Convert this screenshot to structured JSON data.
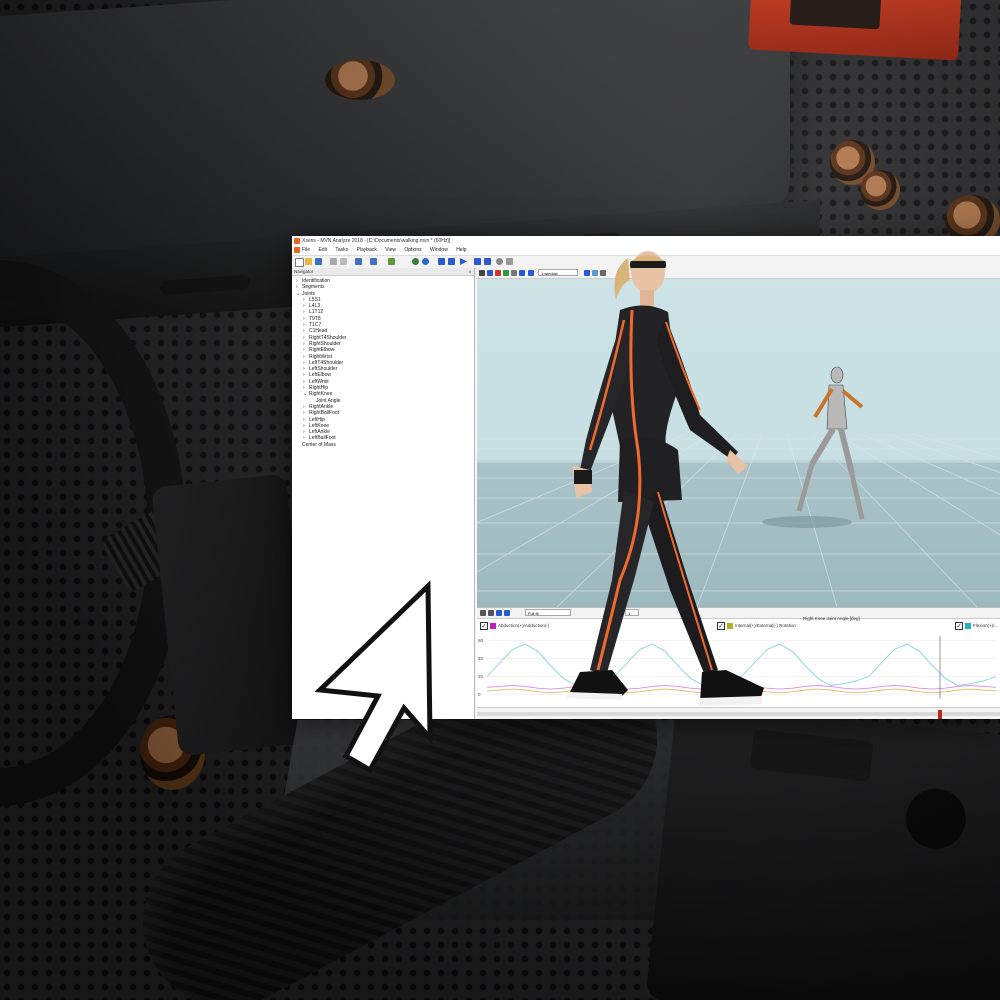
{
  "window": {
    "title": "Xsens - MVN Analyze 2018 - [C:\\Documents\\walking.mvn * (60Hz)]"
  },
  "menu": [
    "File",
    "Edit",
    "Tasks",
    "Playback",
    "View",
    "Options",
    "Window",
    "Help"
  ],
  "navigator": {
    "title": "Navigator",
    "close": "x",
    "items": [
      {
        "label": "Identification",
        "level": 1,
        "expander": "›"
      },
      {
        "label": "Segments",
        "level": 1,
        "expander": "›"
      },
      {
        "label": "Joints",
        "level": 1,
        "expander": "⌄"
      },
      {
        "label": "L5S1",
        "level": 2,
        "expander": "›"
      },
      {
        "label": "L4L3",
        "level": 2,
        "expander": "›"
      },
      {
        "label": "L1T12",
        "level": 2,
        "expander": "›"
      },
      {
        "label": "T9T8",
        "level": 2,
        "expander": "›"
      },
      {
        "label": "T1C7",
        "level": 2,
        "expander": "›"
      },
      {
        "label": "C1Head",
        "level": 2,
        "expander": "›"
      },
      {
        "label": "RightT4Shoulder",
        "level": 2,
        "expander": "›"
      },
      {
        "label": "RightShoulder",
        "level": 2,
        "expander": "›"
      },
      {
        "label": "RightElbow",
        "level": 2,
        "expander": "›"
      },
      {
        "label": "RightWrist",
        "level": 2,
        "expander": "›"
      },
      {
        "label": "LeftT4Shoulder",
        "level": 2,
        "expander": "›"
      },
      {
        "label": "LeftShoulder",
        "level": 2,
        "expander": "›"
      },
      {
        "label": "LeftElbow",
        "level": 2,
        "expander": "›"
      },
      {
        "label": "LeftWrist",
        "level": 2,
        "expander": "›"
      },
      {
        "label": "RightHip",
        "level": 2,
        "expander": "›"
      },
      {
        "label": "RightKnee",
        "level": 2,
        "expander": "⌄"
      },
      {
        "label": "Joint Angle",
        "level": 3,
        "expander": ""
      },
      {
        "label": "RightAnkle",
        "level": 2,
        "expander": "›"
      },
      {
        "label": "RightBallFoot",
        "level": 2,
        "expander": "›"
      },
      {
        "label": "LeftHip",
        "level": 2,
        "expander": "›"
      },
      {
        "label": "LeftKnee",
        "level": 2,
        "expander": "›"
      },
      {
        "label": "LeftAnkle",
        "level": 2,
        "expander": "›"
      },
      {
        "label": "LeftBallFoot",
        "level": 2,
        "expander": "›"
      },
      {
        "label": "Center of Mass",
        "level": 1,
        "expander": ""
      }
    ]
  },
  "viewport": {
    "window_select": "1 window"
  },
  "graph": {
    "zoom_select": "Full fit",
    "page_spin": "1",
    "page_spin2": "1",
    "title": "Right Knee Joint Angle [deg]",
    "legend": [
      {
        "label": "Abduction(+)/Adduction(-)",
        "color": "#c020c0"
      },
      {
        "label": "Internal(+)/External(-) Rotation",
        "color": "#b0b020"
      },
      {
        "label": "Flexion(+)/...",
        "color": "#20b0c0"
      }
    ],
    "y_ticks": [
      "60",
      "40",
      "20",
      "0"
    ]
  },
  "chart_data": {
    "type": "line",
    "title": "Right Knee Joint Angle [deg]",
    "ylim": [
      -5,
      65
    ],
    "y_ticks": [
      0,
      20,
      40,
      60
    ],
    "x": [
      0,
      1,
      2,
      3,
      4,
      5,
      6,
      7,
      8,
      9,
      10,
      11,
      12,
      13,
      14,
      15,
      16,
      17,
      18,
      19,
      20,
      21,
      22,
      23,
      24,
      25,
      26,
      27,
      28,
      29,
      30,
      31,
      32,
      33,
      34,
      35,
      36,
      37,
      38,
      39,
      40
    ],
    "series": [
      {
        "name": "Abduction(+)/Adduction(-)",
        "color": "#e08ae0",
        "values": [
          8,
          9,
          10,
          9,
          7,
          6,
          7,
          9,
          10,
          9,
          7,
          6,
          7,
          9,
          10,
          9,
          7,
          6,
          7,
          9,
          10,
          9,
          7,
          6,
          7,
          9,
          10,
          9,
          7,
          6,
          7,
          9,
          10,
          9,
          7,
          6,
          7,
          9,
          10,
          9,
          8
        ]
      },
      {
        "name": "Internal(+)/External(-) Rotation",
        "color": "#d8c060",
        "values": [
          4,
          5,
          6,
          5,
          3,
          2,
          3,
          5,
          6,
          5,
          3,
          2,
          3,
          5,
          6,
          5,
          3,
          2,
          3,
          5,
          6,
          5,
          3,
          2,
          3,
          5,
          6,
          5,
          3,
          2,
          3,
          5,
          6,
          5,
          3,
          2,
          3,
          5,
          6,
          5,
          4
        ]
      },
      {
        "name": "Flexion(+)/...",
        "color": "#7fd3e0",
        "values": [
          20,
          35,
          50,
          56,
          48,
          32,
          18,
          10,
          12,
          15,
          20,
          35,
          50,
          56,
          48,
          32,
          18,
          10,
          12,
          15,
          20,
          35,
          50,
          56,
          48,
          32,
          18,
          10,
          12,
          15,
          20,
          35,
          50,
          56,
          48,
          32,
          18,
          10,
          12,
          15,
          20
        ]
      }
    ]
  },
  "colors": {
    "accent": "#e8661b",
    "suit_stripe": "#f06a30",
    "scene_sky": "#cde3e6",
    "scene_floor": "#9eb9be"
  }
}
